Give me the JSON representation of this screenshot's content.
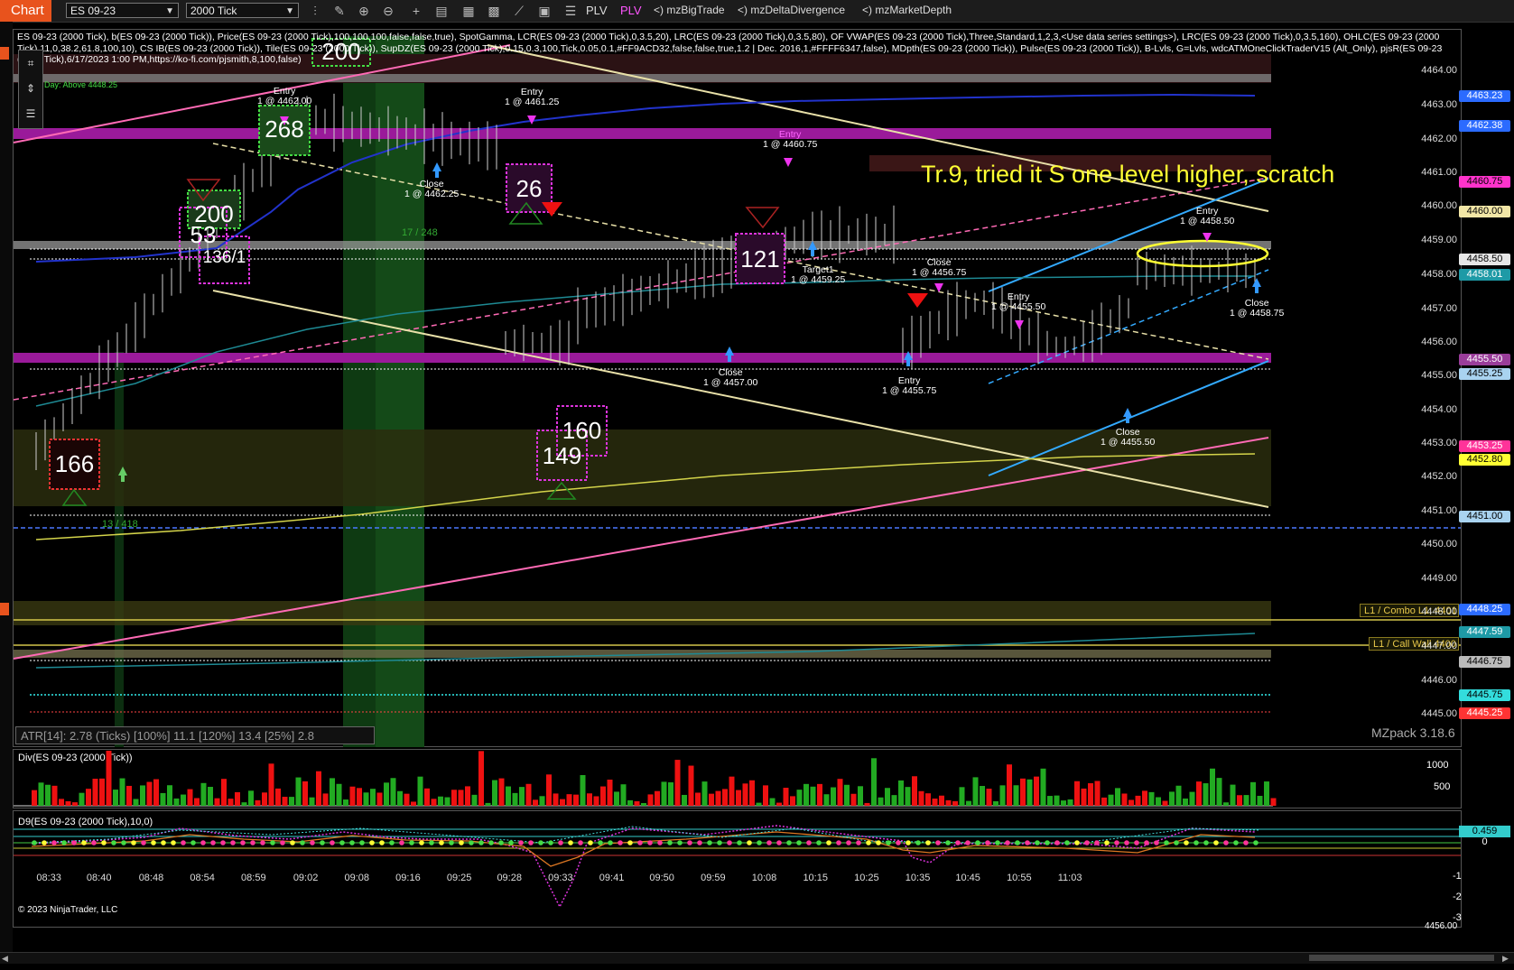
{
  "toolbar": {
    "title": "Chart",
    "instrument": "ES 09-23",
    "period": "2000 Tick",
    "plv1": "PLV",
    "plv2": "PLV",
    "links": [
      "<) mzBigTrade",
      "<) mzDeltaDivergence",
      "<) mzMarketDepth"
    ]
  },
  "colors": {
    "accent": "#e8531d",
    "magenta": "#cc33cc",
    "annotation": "#ffff33"
  },
  "info_text": "ES 09-23 (2000 Tick), b(ES 09-23 (2000 Tick)), Price(ES 09-23 (2000 Tick),100,100,100,false,false,true), SpotGamma, LCR(ES 09-23 (2000 Tick),0,3.5,20), LRC(ES 09-23 (2000 Tick),0,3.5,80), OF VWAP(ES 09-23 (2000 Tick),Three,Standard,1,2,3,<Use data series settings>), LRC(ES 09-23 (2000 Tick),0,3.5,160), OHLC(ES 09-23 (2000 Tick),11,0,38.2,61.8,100,10), CS IB(ES 09-23 (2000 Tick)), Tile(ES 09-23 (2000 Tick)), SupDZ(ES 09-23 (2000 Tick),0.15,0.3,100,Tick,0.05,0.1,#FF9ACD32,false,false,true,1.2 | Dec. 2016,1,#FFFF6347,false), MDpth(ES 09-23 (2000 Tick)), Pulse(ES 09-23 (2000 Tick)), B-Lvls, G=Lvls, wdcATMOneClickTraderV15 (Alt_Only), pjsR(ES 09-23 (2000 Tick),6/17/2023 1:00 PM,https://ko-fi.com/pjsmith,8,100,false)",
  "day_label": "Day: Above 4448.25",
  "annotation": "Tr.9, tried it S one level higher, scratch",
  "price_axis": [
    "4464.00",
    "4463.00",
    "4462.00",
    "4461.00",
    "4460.00",
    "4459.00",
    "4458.00",
    "4457.00",
    "4456.00",
    "4455.00",
    "4454.00",
    "4453.00",
    "4452.00",
    "4451.00",
    "4450.00",
    "4449.00",
    "4448.00",
    "4447.00",
    "4446.00",
    "4445.00"
  ],
  "price_tags": [
    {
      "label": "4463.23",
      "color": "#2b6bff"
    },
    {
      "label": "4462.38",
      "color": "#2b6bff"
    },
    {
      "label": "4460.75",
      "color": "#ff33cc"
    },
    {
      "label": "4460.00",
      "color": "#f2e6a6"
    },
    {
      "label": "4458.50",
      "color": "#e6e6e6"
    },
    {
      "label": "4458.01",
      "color": "#1e9aa6"
    },
    {
      "label": "4455.50",
      "color": "#9a3d9a"
    },
    {
      "label": "4455.25",
      "color": "#a9d3f0"
    },
    {
      "label": "4453.25",
      "color": "#ff3399"
    },
    {
      "label": "4452.80",
      "color": "#ffff33"
    },
    {
      "label": "4451.00",
      "color": "#a9d3f0"
    },
    {
      "label": "4448.25",
      "color": "#2b6bff"
    },
    {
      "label": "4447.59",
      "color": "#1e9aa6"
    },
    {
      "label": "4446.75",
      "color": "#bbbbbb"
    },
    {
      "label": "4445.75",
      "color": "#33dddd"
    },
    {
      "label": "4445.25",
      "color": "#ff3333"
    }
  ],
  "level_labels": [
    "L1 / Combo L1: 4401",
    "L1 / Call Wall 4400"
  ],
  "volume_boxes": [
    "200",
    "268",
    "26",
    "200",
    "53",
    "136/1",
    "121",
    "166",
    "160",
    "149"
  ],
  "trades": [
    {
      "l1": "Entry",
      "l2": "1 @ 4462.00"
    },
    {
      "l1": "Entry",
      "l2": "1 @ 4461.25"
    },
    {
      "l1": "Close",
      "l2": "1 @ 4462.25"
    },
    {
      "l1": "Entry",
      "l2": "1 @ 4460.75"
    },
    {
      "l1": "Target1",
      "l2": "1 @ 4459.25"
    },
    {
      "l1": "Close",
      "l2": "1 @ 4457.00"
    },
    {
      "l1": "Close",
      "l2": "1 @ 4456.75"
    },
    {
      "l1": "Entry",
      "l2": "1 @ 4455.75"
    },
    {
      "l1": "Entry",
      "l2": "1 @ 4455.50"
    },
    {
      "l1": "Close",
      "l2": "1 @ 4455.50"
    },
    {
      "l1": "Entry",
      "l2": "1 @ 4458.50"
    },
    {
      "l1": "Close",
      "l2": "1 @ 4458.75"
    }
  ],
  "delta_labels": [
    "17 / 248",
    "13 / 418"
  ],
  "atr_text": "ATR[14]: 2.78 (Ticks) [100%] 11.1  [120%] 13.4  [25%] 2.8",
  "mzpack": "MZpack 3.18.6",
  "div_panel": {
    "title": "Div(ES 09-23 (2000 Tick))",
    "axis": [
      "1000",
      "500"
    ]
  },
  "d9_panel": {
    "title": "D9(ES 09-23 (2000 Tick),10,0)",
    "axis": [
      "0",
      "-1",
      "-2",
      "-3",
      "4456.00"
    ],
    "tag": "0.459"
  },
  "copyright": "© 2023 NinjaTrader, LLC",
  "time_axis": [
    "08:33",
    "08:40",
    "08:48",
    "08:54",
    "08:59",
    "09:02",
    "09:08",
    "09:16",
    "09:25",
    "09:28",
    "09:33",
    "09:41",
    "09:50",
    "09:59",
    "10:08",
    "10:15",
    "10:25",
    "10:35",
    "10:45",
    "10:55",
    "11:03"
  ]
}
